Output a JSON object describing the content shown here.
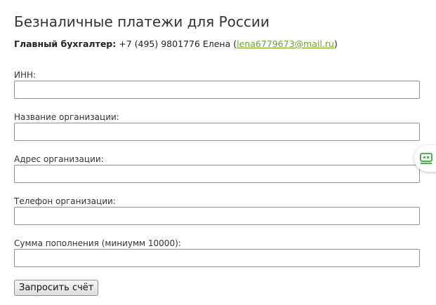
{
  "page": {
    "title": "Безналичные платежи для России"
  },
  "contact": {
    "label": "Главный бухгалтер:",
    "phone_name": " +7 (495) 9801776 Елена (",
    "email": "lena6779673@mail.ru",
    "closing": ")"
  },
  "form": {
    "fields": [
      {
        "label": "ИНН:",
        "value": ""
      },
      {
        "label": "Название организации:",
        "value": ""
      },
      {
        "label": "Адрес организации:",
        "value": ""
      },
      {
        "label": "Телефон организации:",
        "value": ""
      },
      {
        "label": "Сумма пополнения (миниумм 10000):",
        "value": ""
      }
    ],
    "submit_label": "Запросить счёт"
  },
  "widget": {
    "icon": "chat-icon",
    "accent_color": "#4caf50"
  },
  "colors": {
    "link": "#6aa820",
    "text": "#333333"
  }
}
